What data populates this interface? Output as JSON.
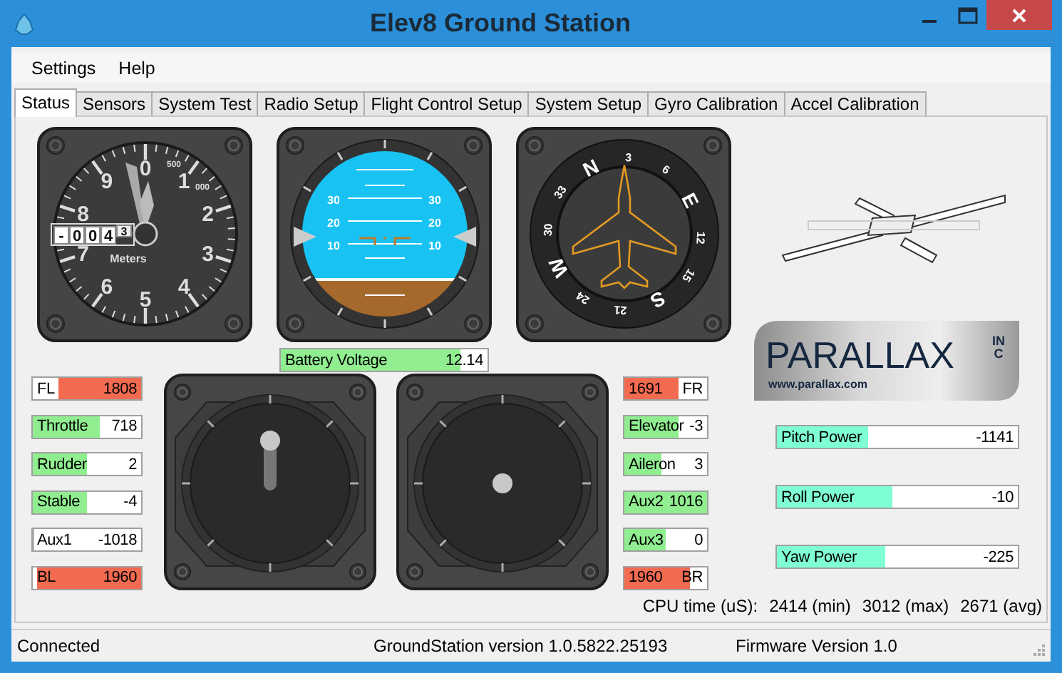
{
  "window": {
    "title": "Elev8 Ground Station"
  },
  "menu": [
    "Settings",
    "Help"
  ],
  "tabs": [
    {
      "label": "Status",
      "selected": true
    },
    {
      "label": "Sensors",
      "selected": false
    },
    {
      "label": "System Test",
      "selected": false
    },
    {
      "label": "Radio Setup",
      "selected": false
    },
    {
      "label": "Flight Control Setup",
      "selected": false
    },
    {
      "label": "System Setup",
      "selected": false
    },
    {
      "label": "Gyro Calibration",
      "selected": false
    },
    {
      "label": "Accel Calibration",
      "selected": false
    }
  ],
  "altimeter": {
    "dial_labels": [
      "0",
      "1",
      "2",
      "3",
      "4",
      "5",
      "6",
      "7",
      "8",
      "9"
    ],
    "hundreds_label": "500",
    "thousands_suffix": "000",
    "counter": [
      "-",
      "0",
      "0",
      "4",
      "3"
    ],
    "unit": "Meters"
  },
  "attitude": {
    "left_labels": [
      "30",
      "20",
      "10"
    ],
    "right_labels": [
      "30",
      "20",
      "10"
    ]
  },
  "heading": {
    "labels": [
      "N",
      "3",
      "6",
      "E",
      "12",
      "15",
      "S",
      "21",
      "24",
      "W",
      "30",
      "33"
    ]
  },
  "battery": {
    "label": "Battery Voltage",
    "value": "12.14",
    "level": 0.87,
    "color": "#90ee90"
  },
  "left_channels": [
    {
      "label": "FL",
      "value": "1808",
      "level": 0.76,
      "color": "#f26b50",
      "kind": "motor"
    },
    {
      "label": "Throttle",
      "value": "718",
      "level": 0.62,
      "color": "#90ee90",
      "kind": "channel"
    },
    {
      "label": "Rudder",
      "value": "2",
      "level": 0.5,
      "color": "#90ee90",
      "kind": "channel"
    },
    {
      "label": "Stable",
      "value": "-4",
      "level": 0.5,
      "color": "#90ee90",
      "kind": "channel"
    },
    {
      "label": "Aux1",
      "value": "-1018",
      "level": 0,
      "kind": "channel"
    },
    {
      "label": "BL",
      "value": "1960",
      "level": 0.96,
      "color": "#f26b50",
      "kind": "motor"
    }
  ],
  "right_channels": [
    {
      "label": "FR",
      "value": "1691",
      "level": 0.66,
      "color": "#f26b50",
      "kind": "motor"
    },
    {
      "label": "Elevator",
      "value": "-3",
      "level": 0.65,
      "color": "#90ee90",
      "kind": "channel"
    },
    {
      "label": "Aileron",
      "value": "3",
      "level": 0.45,
      "color": "#90ee90",
      "kind": "channel"
    },
    {
      "label": "Aux2",
      "value": "1016",
      "level": 1,
      "color": "#90ee90",
      "kind": "channel"
    },
    {
      "label": "Aux3",
      "value": "0",
      "level": 0.5,
      "color": "#90ee90",
      "kind": "channel"
    },
    {
      "label": "BR",
      "value": "1960",
      "level": 0.8,
      "color": "#f26b50",
      "kind": "motor"
    }
  ],
  "logo": {
    "name": "PARALLAX",
    "suffix": [
      "I",
      "N",
      "C"
    ],
    "url": "www.parallax.com"
  },
  "power": [
    {
      "label": "Pitch Power",
      "value": "-1141",
      "level": 0.38
    },
    {
      "label": "Roll Power",
      "value": "-10",
      "level": 0.48
    },
    {
      "label": "Yaw Power",
      "value": "-225",
      "level": 0.45
    }
  ],
  "cpu": {
    "label": "CPU time (uS):",
    "min": "2414 (min)",
    "max": "3012 (max)",
    "avg": "2671 (avg)"
  },
  "status_bar": {
    "connection": "Connected",
    "version": "GroundStation version 1.0.5822.25193",
    "firmware": "Firmware Version 1.0"
  }
}
